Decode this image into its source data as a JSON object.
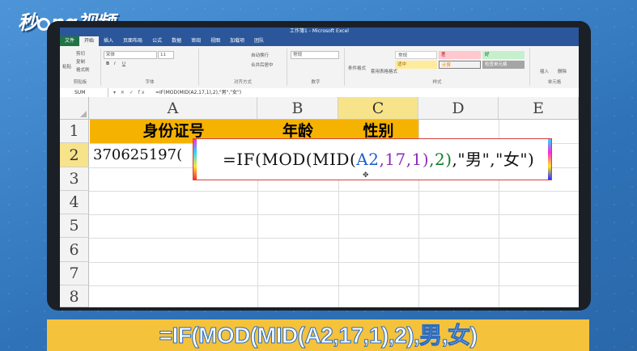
{
  "brand": {
    "logo_text_a": "秒",
    "logo_text_b": "ng视频"
  },
  "window": {
    "title": "工作簿1 - Microsoft Excel"
  },
  "ribbon_tabs": [
    {
      "label": "文件"
    },
    {
      "label": "开始"
    },
    {
      "label": "插入"
    },
    {
      "label": "页面布局"
    },
    {
      "label": "公式"
    },
    {
      "label": "数据"
    },
    {
      "label": "审阅"
    },
    {
      "label": "视图"
    },
    {
      "label": "加载项"
    },
    {
      "label": "团队"
    }
  ],
  "ribbon": {
    "clipboard": {
      "cut": "剪切",
      "copy": "复制",
      "format_painter": "格式刷",
      "paste": "粘贴",
      "label": "剪贴板"
    },
    "font": {
      "name": "宋体",
      "size": "11",
      "label": "字体"
    },
    "alignment": {
      "wrap": "自动换行",
      "merge": "合并后居中",
      "label": "对齐方式"
    },
    "number": {
      "format": "常规",
      "label": "数字"
    },
    "styles": {
      "conditional": "条件格式",
      "table": "套用表格格式",
      "normal": "常规",
      "bad": "差",
      "good": "好",
      "neutral": "适中",
      "calc": "计算",
      "check": "检查单元格",
      "label": "样式"
    },
    "cells": {
      "insert": "插入",
      "delete": "删除",
      "label": "单元格"
    }
  },
  "formula_bar": {
    "name_box": "SUM",
    "icons": "▾ ✕ ✓ fx",
    "content": "=IF(MOD(MID(A2,17,1),2),\"男\",\"女\")"
  },
  "sheet": {
    "columns": [
      "A",
      "B",
      "C",
      "D",
      "E"
    ],
    "rows": [
      "1",
      "2",
      "3",
      "4",
      "5",
      "6",
      "7",
      "8"
    ],
    "header_cells": {
      "A1": "身份证号",
      "B1": "年龄",
      "C1": "性别"
    },
    "A2": "370625197("
  },
  "editor": {
    "part1": "=IF(MOD(MID(",
    "part2": "A2",
    "part3": ",17,1)",
    "part4": ",2)",
    "part5": ",\"男\",\"女\")"
  },
  "caption": "=IF(MOD(MID(A2,17,1),2),男,女)",
  "colors": {
    "header_fill": "#f5b200",
    "selection": "#217346",
    "excel_blue": "#2b579a",
    "banner": "#f5c23c"
  }
}
